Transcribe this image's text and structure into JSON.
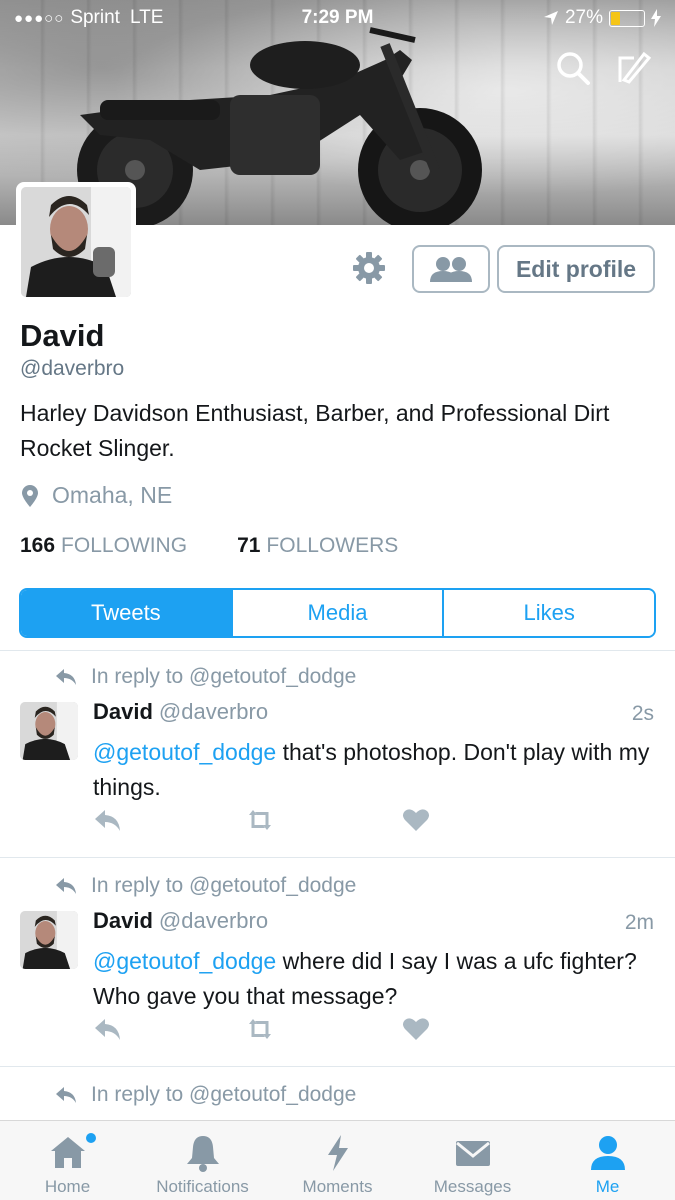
{
  "status_bar": {
    "signal_dots": "●●●○○",
    "carrier": "Sprint",
    "network": "LTE",
    "time": "7:29 PM",
    "battery": "27%",
    "battery_level": 0.27
  },
  "header": {
    "search_icon": "search-icon",
    "compose_icon": "compose-icon"
  },
  "profile": {
    "name": "David",
    "handle": "@daverbro",
    "bio": "Harley Davidson Enthusiast, Barber, and Professional Dirt Rocket Slinger.",
    "location": "Omaha, NE",
    "edit_label": "Edit profile",
    "following_count": "166",
    "following_label": "FOLLOWING",
    "followers_count": "71",
    "followers_label": "FOLLOWERS"
  },
  "tabs": [
    {
      "label": "Tweets",
      "active": true
    },
    {
      "label": "Media",
      "active": false
    },
    {
      "label": "Likes",
      "active": false
    }
  ],
  "tweets": [
    {
      "reply_to": "In reply to @getoutof_dodge",
      "name": "David",
      "handle": "@daverbro",
      "time": "2s",
      "mention": "@getoutof_dodge",
      "text": " that's photoshop. Don't play with my things."
    },
    {
      "reply_to": "In reply to @getoutof_dodge",
      "name": "David",
      "handle": "@daverbro",
      "time": "2m",
      "mention": "@getoutof_dodge",
      "text": " where did I say I was a ufc fighter? Who gave you that message?"
    },
    {
      "reply_to": "In reply to @getoutof_dodge"
    }
  ],
  "nav": [
    {
      "label": "Home",
      "icon": "home-icon",
      "active": false
    },
    {
      "label": "Notifications",
      "icon": "bell-icon",
      "active": false
    },
    {
      "label": "Moments",
      "icon": "lightning-icon",
      "active": false
    },
    {
      "label": "Messages",
      "icon": "envelope-icon",
      "active": false
    },
    {
      "label": "Me",
      "icon": "person-icon",
      "active": true
    }
  ],
  "colors": {
    "accent": "#1da1f2",
    "muted": "#8899a6",
    "text": "#14171a"
  }
}
